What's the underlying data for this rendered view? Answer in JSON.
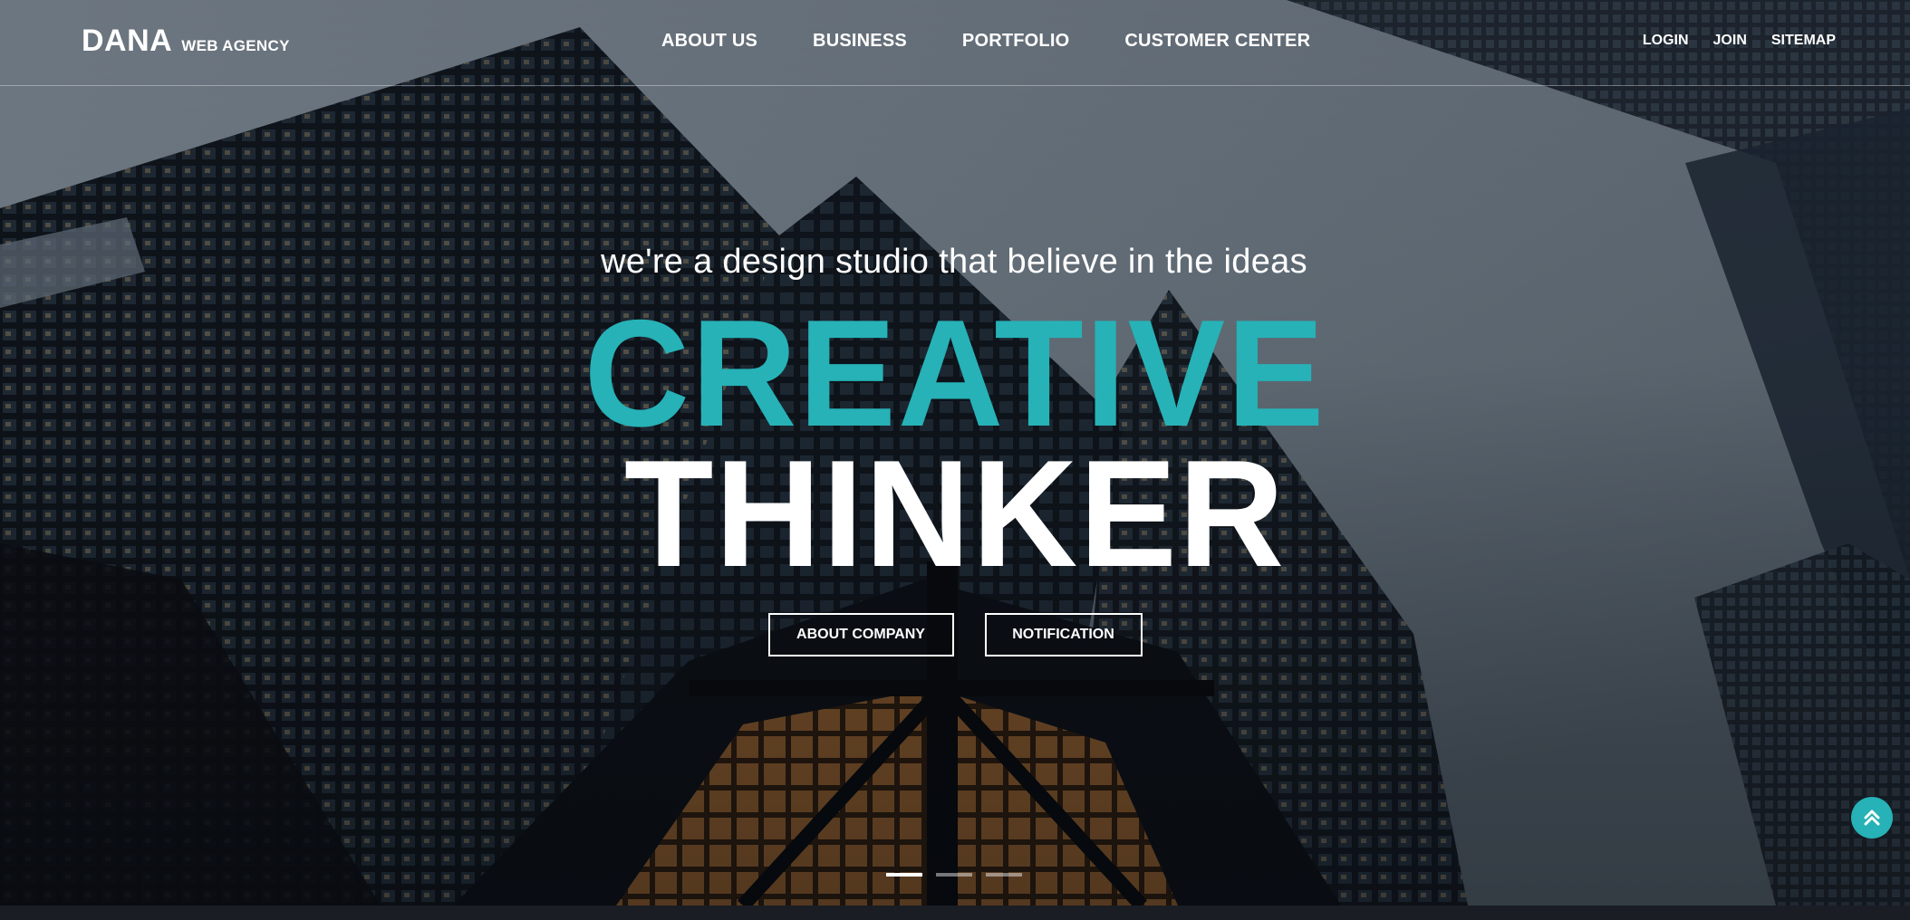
{
  "header": {
    "brand": "DANA",
    "brand_sub": "WEB AGENCY",
    "nav": [
      {
        "label": "ABOUT US"
      },
      {
        "label": "BUSINESS"
      },
      {
        "label": "PORTFOLIO"
      },
      {
        "label": "CUSTOMER CENTER"
      }
    ],
    "util": [
      {
        "label": "LOGIN"
      },
      {
        "label": "JOIN"
      },
      {
        "label": "SITEMAP"
      }
    ]
  },
  "hero": {
    "tagline": "we're a design studio that believe in the ideas",
    "headline_1": "CREATIVE",
    "headline_2": "THINKER",
    "buttons": {
      "about": "ABOUT COMPANY",
      "notice": "NOTIFICATION"
    },
    "slides": {
      "total": 3,
      "active": 1
    }
  },
  "icons": {
    "top_button": "double-chevron-up-icon"
  },
  "colors": {
    "accent": "#26b2b7",
    "text": "#ffffff"
  }
}
